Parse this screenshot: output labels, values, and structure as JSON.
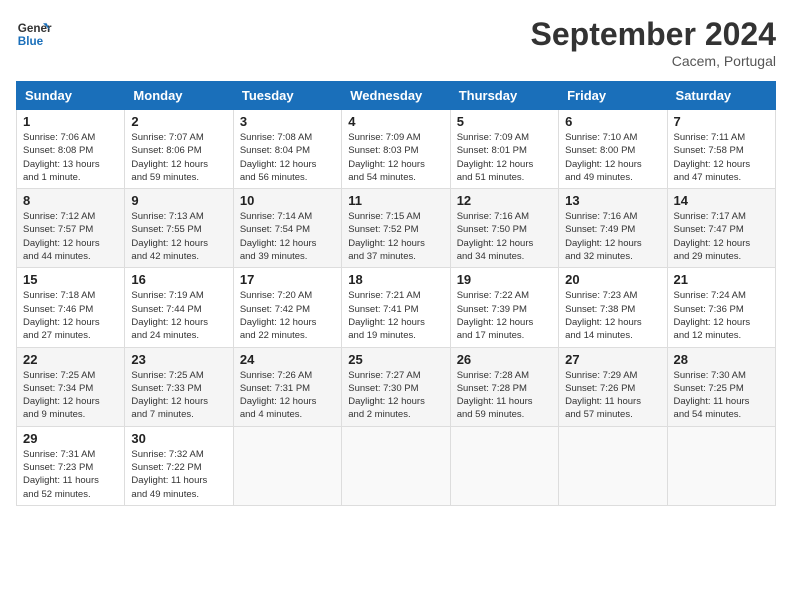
{
  "header": {
    "logo_line1": "General",
    "logo_line2": "Blue",
    "month": "September 2024",
    "location": "Cacem, Portugal"
  },
  "weekdays": [
    "Sunday",
    "Monday",
    "Tuesday",
    "Wednesday",
    "Thursday",
    "Friday",
    "Saturday"
  ],
  "weeks": [
    [
      {
        "day": "1",
        "info": "Sunrise: 7:06 AM\nSunset: 8:08 PM\nDaylight: 13 hours\nand 1 minute."
      },
      {
        "day": "2",
        "info": "Sunrise: 7:07 AM\nSunset: 8:06 PM\nDaylight: 12 hours\nand 59 minutes."
      },
      {
        "day": "3",
        "info": "Sunrise: 7:08 AM\nSunset: 8:04 PM\nDaylight: 12 hours\nand 56 minutes."
      },
      {
        "day": "4",
        "info": "Sunrise: 7:09 AM\nSunset: 8:03 PM\nDaylight: 12 hours\nand 54 minutes."
      },
      {
        "day": "5",
        "info": "Sunrise: 7:09 AM\nSunset: 8:01 PM\nDaylight: 12 hours\nand 51 minutes."
      },
      {
        "day": "6",
        "info": "Sunrise: 7:10 AM\nSunset: 8:00 PM\nDaylight: 12 hours\nand 49 minutes."
      },
      {
        "day": "7",
        "info": "Sunrise: 7:11 AM\nSunset: 7:58 PM\nDaylight: 12 hours\nand 47 minutes."
      }
    ],
    [
      {
        "day": "8",
        "info": "Sunrise: 7:12 AM\nSunset: 7:57 PM\nDaylight: 12 hours\nand 44 minutes."
      },
      {
        "day": "9",
        "info": "Sunrise: 7:13 AM\nSunset: 7:55 PM\nDaylight: 12 hours\nand 42 minutes."
      },
      {
        "day": "10",
        "info": "Sunrise: 7:14 AM\nSunset: 7:54 PM\nDaylight: 12 hours\nand 39 minutes."
      },
      {
        "day": "11",
        "info": "Sunrise: 7:15 AM\nSunset: 7:52 PM\nDaylight: 12 hours\nand 37 minutes."
      },
      {
        "day": "12",
        "info": "Sunrise: 7:16 AM\nSunset: 7:50 PM\nDaylight: 12 hours\nand 34 minutes."
      },
      {
        "day": "13",
        "info": "Sunrise: 7:16 AM\nSunset: 7:49 PM\nDaylight: 12 hours\nand 32 minutes."
      },
      {
        "day": "14",
        "info": "Sunrise: 7:17 AM\nSunset: 7:47 PM\nDaylight: 12 hours\nand 29 minutes."
      }
    ],
    [
      {
        "day": "15",
        "info": "Sunrise: 7:18 AM\nSunset: 7:46 PM\nDaylight: 12 hours\nand 27 minutes."
      },
      {
        "day": "16",
        "info": "Sunrise: 7:19 AM\nSunset: 7:44 PM\nDaylight: 12 hours\nand 24 minutes."
      },
      {
        "day": "17",
        "info": "Sunrise: 7:20 AM\nSunset: 7:42 PM\nDaylight: 12 hours\nand 22 minutes."
      },
      {
        "day": "18",
        "info": "Sunrise: 7:21 AM\nSunset: 7:41 PM\nDaylight: 12 hours\nand 19 minutes."
      },
      {
        "day": "19",
        "info": "Sunrise: 7:22 AM\nSunset: 7:39 PM\nDaylight: 12 hours\nand 17 minutes."
      },
      {
        "day": "20",
        "info": "Sunrise: 7:23 AM\nSunset: 7:38 PM\nDaylight: 12 hours\nand 14 minutes."
      },
      {
        "day": "21",
        "info": "Sunrise: 7:24 AM\nSunset: 7:36 PM\nDaylight: 12 hours\nand 12 minutes."
      }
    ],
    [
      {
        "day": "22",
        "info": "Sunrise: 7:25 AM\nSunset: 7:34 PM\nDaylight: 12 hours\nand 9 minutes."
      },
      {
        "day": "23",
        "info": "Sunrise: 7:25 AM\nSunset: 7:33 PM\nDaylight: 12 hours\nand 7 minutes."
      },
      {
        "day": "24",
        "info": "Sunrise: 7:26 AM\nSunset: 7:31 PM\nDaylight: 12 hours\nand 4 minutes."
      },
      {
        "day": "25",
        "info": "Sunrise: 7:27 AM\nSunset: 7:30 PM\nDaylight: 12 hours\nand 2 minutes."
      },
      {
        "day": "26",
        "info": "Sunrise: 7:28 AM\nSunset: 7:28 PM\nDaylight: 11 hours\nand 59 minutes."
      },
      {
        "day": "27",
        "info": "Sunrise: 7:29 AM\nSunset: 7:26 PM\nDaylight: 11 hours\nand 57 minutes."
      },
      {
        "day": "28",
        "info": "Sunrise: 7:30 AM\nSunset: 7:25 PM\nDaylight: 11 hours\nand 54 minutes."
      }
    ],
    [
      {
        "day": "29",
        "info": "Sunrise: 7:31 AM\nSunset: 7:23 PM\nDaylight: 11 hours\nand 52 minutes."
      },
      {
        "day": "30",
        "info": "Sunrise: 7:32 AM\nSunset: 7:22 PM\nDaylight: 11 hours\nand 49 minutes."
      },
      {
        "day": "",
        "info": ""
      },
      {
        "day": "",
        "info": ""
      },
      {
        "day": "",
        "info": ""
      },
      {
        "day": "",
        "info": ""
      },
      {
        "day": "",
        "info": ""
      }
    ]
  ]
}
